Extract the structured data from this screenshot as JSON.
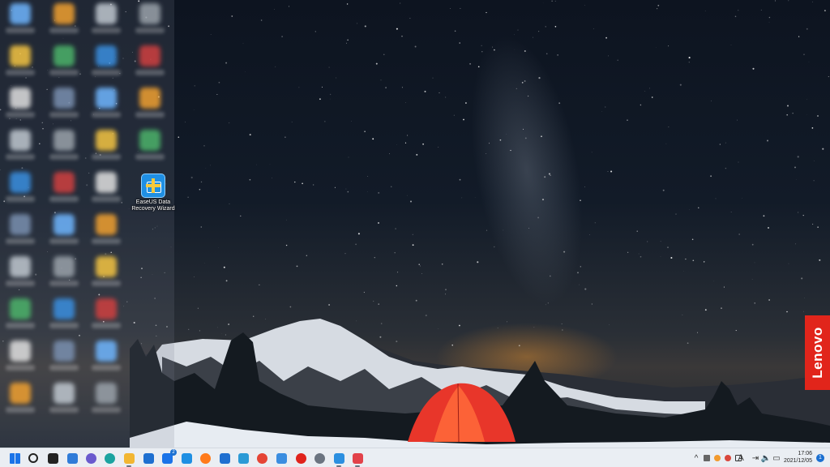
{
  "desktop": {
    "icons": [
      {
        "label": "EaseUS Data Recovery Wizard"
      }
    ]
  },
  "taskbar": {
    "apps": [
      {
        "name": "start-icon",
        "color": "#1a73e8"
      },
      {
        "name": "search-icon",
        "color": "#222222"
      },
      {
        "name": "task-view-icon",
        "color": "#222222"
      },
      {
        "name": "widgets-icon",
        "color": "#2f7bd8"
      },
      {
        "name": "chat-icon",
        "color": "#6a5acd"
      },
      {
        "name": "edge-icon",
        "color": "#1aa3a0"
      },
      {
        "name": "file-explorer-icon",
        "color": "#f2b632"
      },
      {
        "name": "store-icon",
        "color": "#1e6fd0"
      },
      {
        "name": "mail-icon",
        "color": "#1a73e8",
        "badge": "2"
      },
      {
        "name": "l-app-icon",
        "color": "#1f8fe3"
      },
      {
        "name": "firefox-icon",
        "color": "#ff7a1a"
      },
      {
        "name": "edit-app-icon",
        "color": "#1f6fd0"
      },
      {
        "name": "remote-desktop-icon",
        "color": "#2b9ad6"
      },
      {
        "name": "chrome-icon",
        "color": "#e54435"
      },
      {
        "name": "phone-app-icon",
        "color": "#3a8de0"
      },
      {
        "name": "opera-icon",
        "color": "#e0231c"
      },
      {
        "name": "settings-icon",
        "color": "#6b7480"
      },
      {
        "name": "easeus-app-icon",
        "color": "#2b8fe0"
      },
      {
        "name": "snipping-tool-icon",
        "color": "#e2424a"
      }
    ],
    "tray": {
      "chevron": "^",
      "ime": "A",
      "time": "17:06",
      "date": "2021/12/05",
      "notification_count": "1"
    }
  },
  "brand": {
    "badge_text": "Lenovo",
    "badge_color": "#e1251b"
  }
}
